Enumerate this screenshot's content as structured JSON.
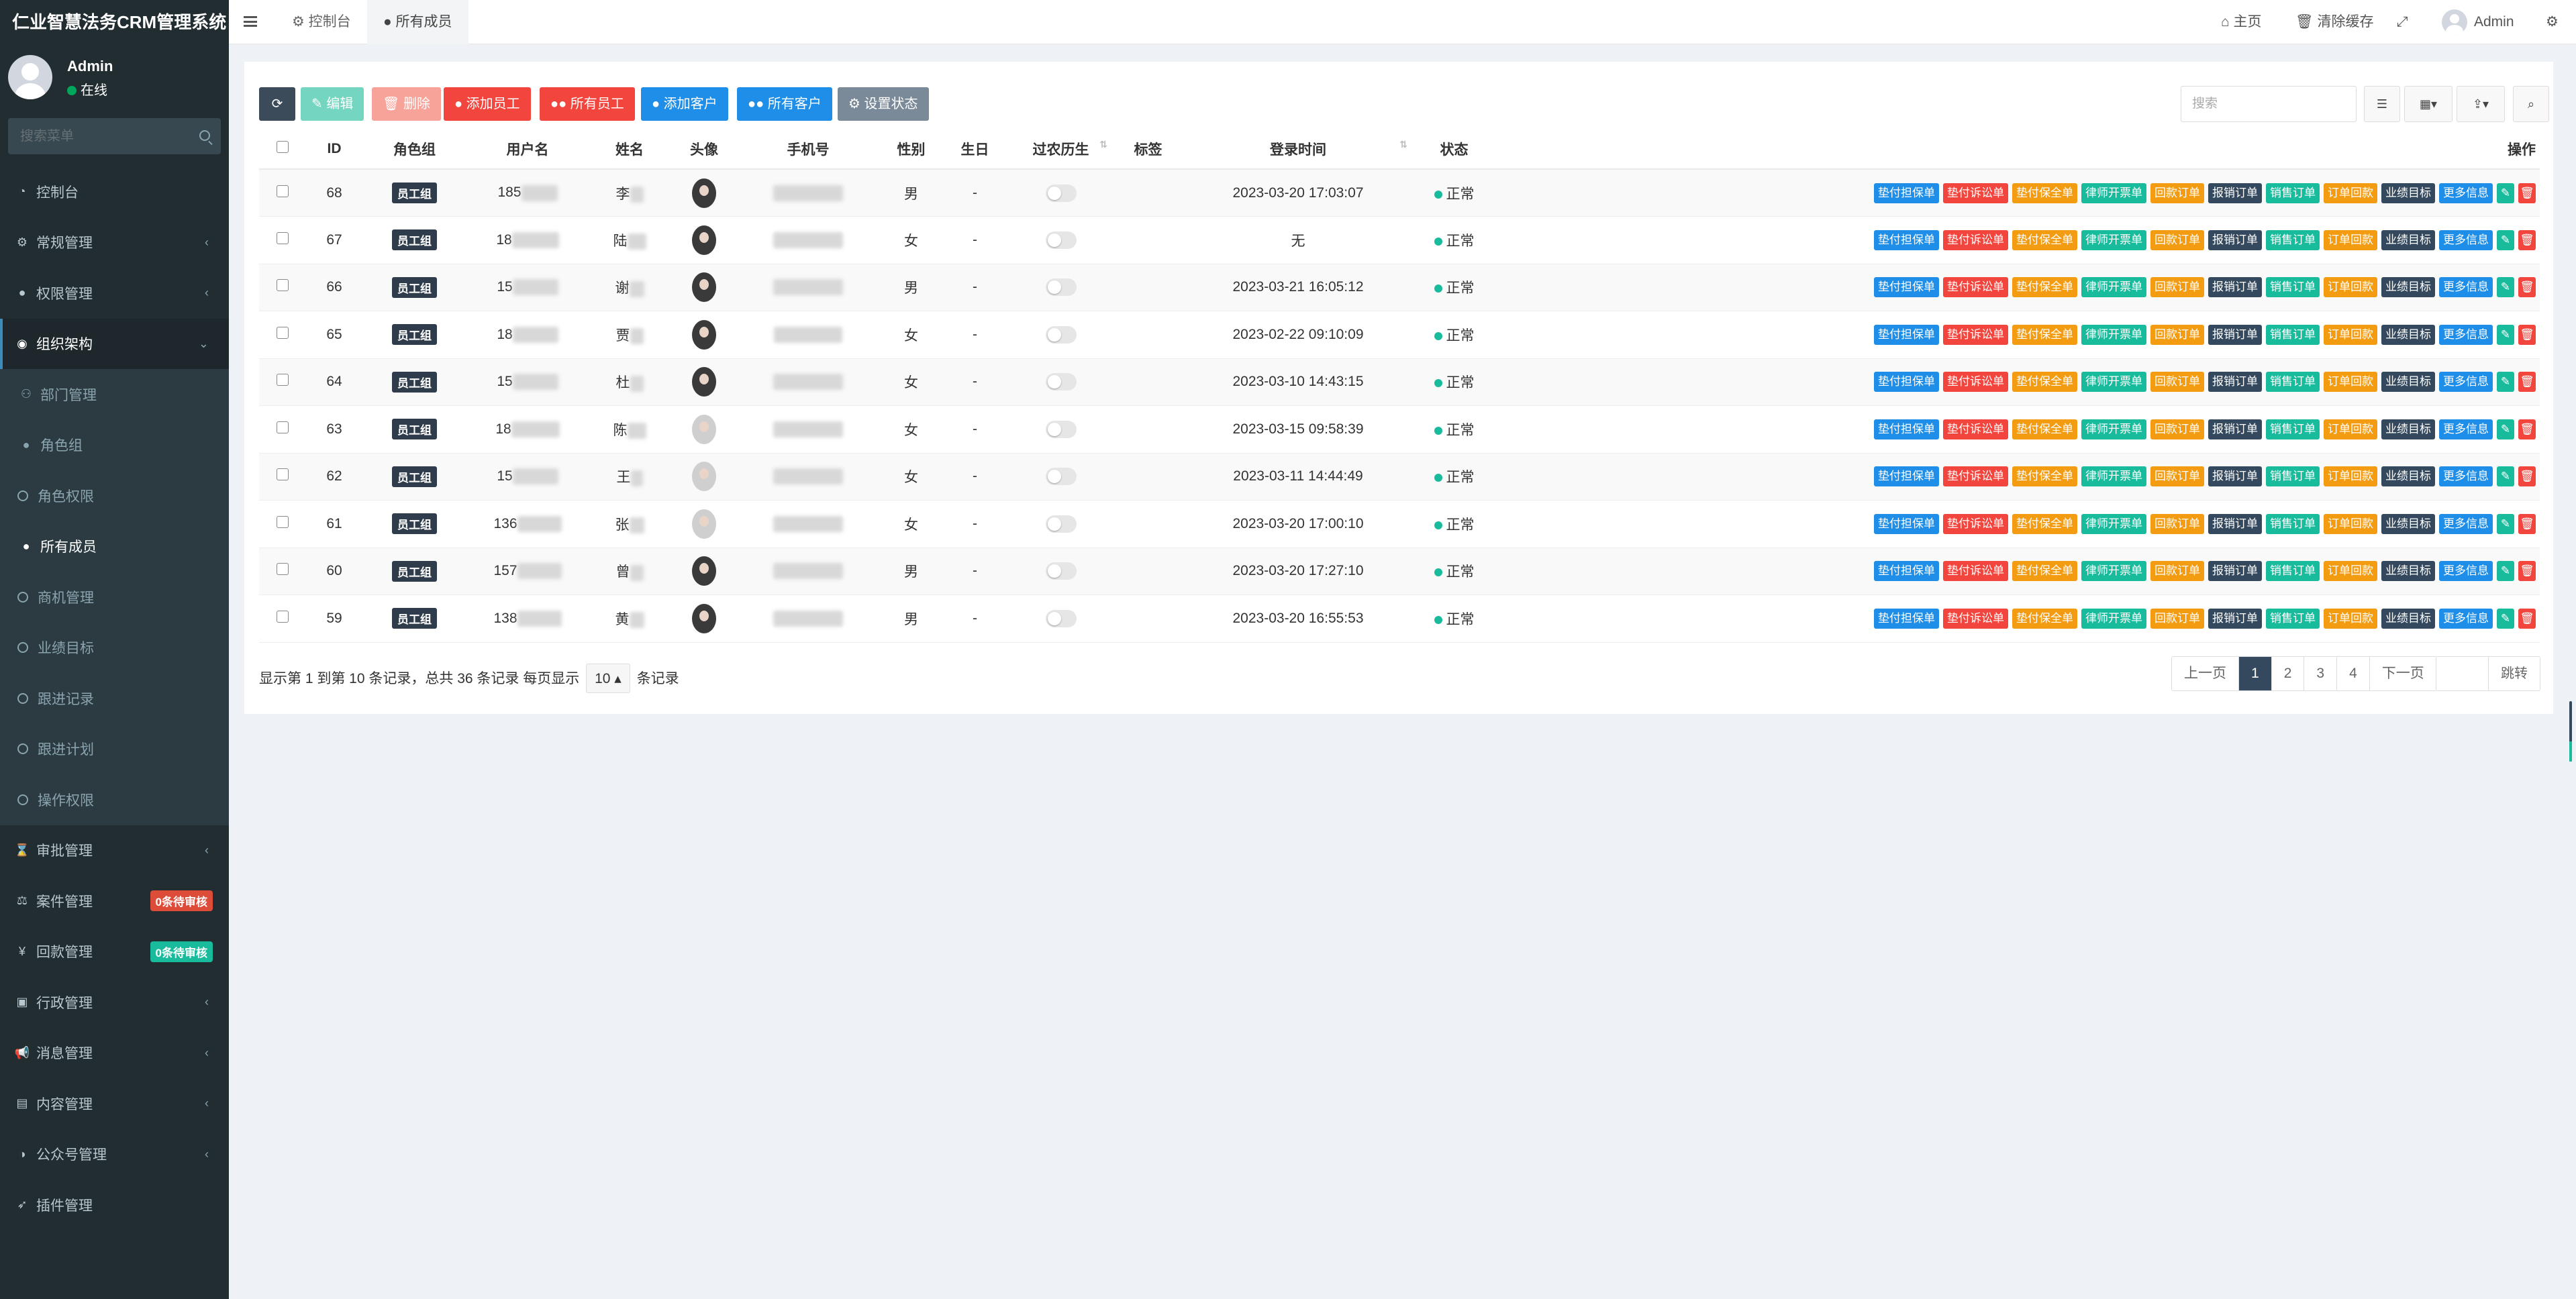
{
  "app": {
    "title": "仁业智慧法务CRM管理系统"
  },
  "user": {
    "name": "Admin",
    "status": "在线"
  },
  "sidebar": {
    "search_placeholder": "搜索菜单",
    "items": [
      {
        "label": "控制台",
        "icon": "dashboard-icon"
      },
      {
        "label": "常规管理",
        "icon": "gears-icon"
      },
      {
        "label": "权限管理",
        "icon": "group-icon"
      },
      {
        "label": "组织架构",
        "icon": "user-circle-icon"
      },
      {
        "label": "部门管理",
        "icon": "sitemap-icon"
      },
      {
        "label": "角色组",
        "icon": "group-icon"
      },
      {
        "label": "角色权限",
        "icon": "circle-icon"
      },
      {
        "label": "所有成员",
        "icon": "user-icon"
      },
      {
        "label": "商机管理",
        "icon": "circle-icon"
      },
      {
        "label": "业绩目标",
        "icon": "circle-icon"
      },
      {
        "label": "跟进记录",
        "icon": "circle-icon"
      },
      {
        "label": "跟进计划",
        "icon": "circle-icon"
      },
      {
        "label": "操作权限",
        "icon": "circle-icon"
      },
      {
        "label": "审批管理",
        "icon": "hourglass-icon"
      },
      {
        "label": "案件管理",
        "icon": "scale-icon",
        "badge": "0条待审核",
        "badge_color": "#dd4b39"
      },
      {
        "label": "回款管理",
        "icon": "yen-icon",
        "badge": "0条待审核",
        "badge_color": "#18bc9c"
      },
      {
        "label": "行政管理",
        "icon": "building-icon"
      },
      {
        "label": "消息管理",
        "icon": "bullhorn-icon"
      },
      {
        "label": "内容管理",
        "icon": "id-card-icon"
      },
      {
        "label": "公众号管理",
        "icon": "wechat-icon"
      },
      {
        "label": "插件管理",
        "icon": "rocket-icon"
      }
    ]
  },
  "topbar": {
    "tabs": [
      {
        "label": "控制台"
      },
      {
        "label": "所有成员"
      }
    ],
    "home": "主页",
    "clear_cache": "清除缓存",
    "admin": "Admin"
  },
  "toolbar": {
    "refresh": "",
    "edit": "编辑",
    "delete": "删除",
    "add_employee": "添加员工",
    "all_employees": "所有员工",
    "add_customer": "添加客户",
    "all_customers": "所有客户",
    "set_status": "设置状态",
    "search_placeholder": "搜索"
  },
  "table": {
    "headers": [
      "ID",
      "角色组",
      "用户名",
      "姓名",
      "头像",
      "手机号",
      "性别",
      "生日",
      "过农历生",
      "标签",
      "登录时间",
      "状态",
      "操作"
    ],
    "role_label": "员工组",
    "status_label": "正常",
    "row_buttons": [
      "垫付担保单",
      "垫付诉讼单",
      "垫付保全单",
      "律师开票单",
      "回款订单",
      "报销订单",
      "销售订单",
      "订单回款",
      "业绩目标",
      "更多信息"
    ],
    "rows": [
      {
        "id": "68",
        "username": "185",
        "name": "李",
        "gender": "男",
        "birthday": "-",
        "login": "2023-03-20 17:03:07"
      },
      {
        "id": "67",
        "username": "18",
        "name": "陆",
        "gender": "女",
        "birthday": "-",
        "login": "无"
      },
      {
        "id": "66",
        "username": "15",
        "name": "谢",
        "gender": "男",
        "birthday": "-",
        "login": "2023-03-21 16:05:12"
      },
      {
        "id": "65",
        "username": "18",
        "name": "贾",
        "gender": "女",
        "birthday": "-",
        "login": "2023-02-22 09:10:09"
      },
      {
        "id": "64",
        "username": "15",
        "name": "杜",
        "gender": "女",
        "birthday": "-",
        "login": "2023-03-10 14:43:15"
      },
      {
        "id": "63",
        "username": "18",
        "name": "陈",
        "gender": "女",
        "birthday": "-",
        "login": "2023-03-15 09:58:39"
      },
      {
        "id": "62",
        "username": "15",
        "name": "王",
        "gender": "女",
        "birthday": "-",
        "login": "2023-03-11 14:44:49"
      },
      {
        "id": "61",
        "username": "136",
        "name": "张",
        "gender": "女",
        "birthday": "-",
        "login": "2023-03-20 17:00:10"
      },
      {
        "id": "60",
        "username": "157",
        "name": "曾",
        "gender": "男",
        "birthday": "-",
        "login": "2023-03-20 17:27:10"
      },
      {
        "id": "59",
        "username": "138",
        "name": "黄",
        "gender": "男",
        "birthday": "-",
        "login": "2023-03-20 16:55:53"
      }
    ]
  },
  "pagination": {
    "info_prefix": "显示第 1 到第 10 条记录，总共 36 条记录 每页显示",
    "page_size": "10",
    "info_suffix": "条记录",
    "prev": "上一页",
    "pages": [
      "1",
      "2",
      "3",
      "4"
    ],
    "next": "下一页",
    "jump": "跳转"
  }
}
